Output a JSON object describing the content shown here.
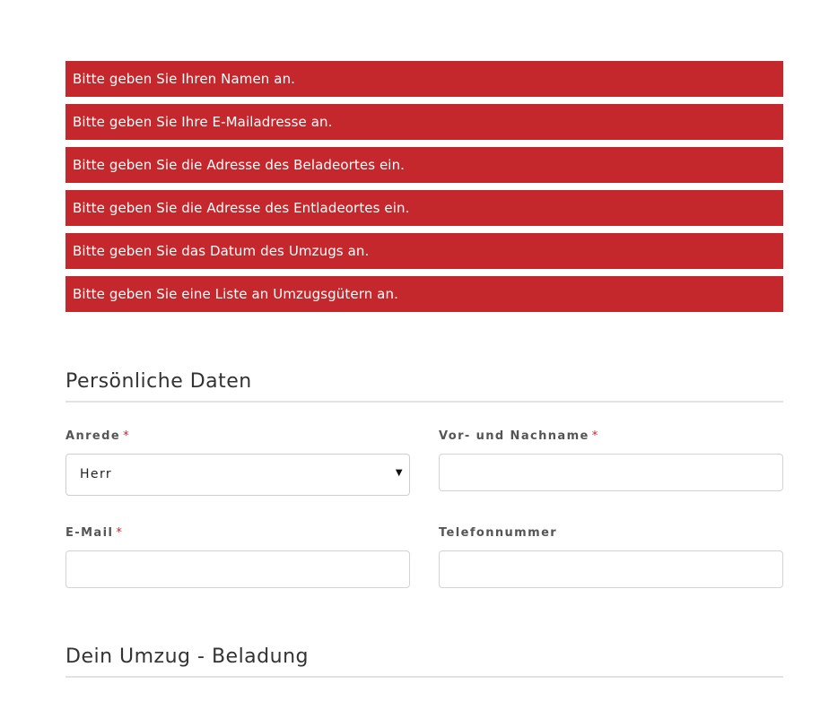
{
  "errors": [
    "Bitte geben Sie Ihren Namen an.",
    "Bitte geben Sie Ihre E-Mailadresse an.",
    "Bitte geben Sie die Adresse des Beladeortes ein.",
    "Bitte geben Sie die Adresse des Entladeortes ein.",
    "Bitte geben Sie das Datum des Umzugs an.",
    "Bitte geben Sie eine Liste an Umzugsgütern an."
  ],
  "personal": {
    "title": "Persönliche Daten",
    "anrede": {
      "label": "Anrede",
      "required_mark": "*",
      "selected": "Herr"
    },
    "name": {
      "label": "Vor- und Nachname",
      "required_mark": "*",
      "value": ""
    },
    "email": {
      "label": "E-Mail",
      "required_mark": "*",
      "value": ""
    },
    "phone": {
      "label": "Telefonnummer",
      "value": ""
    }
  },
  "loading": {
    "title": "Dein Umzug - Beladung"
  },
  "icons": {
    "select_caret": "triangle-down-icon"
  },
  "colors": {
    "error_bg": "#c4282d",
    "required": "#c4282d",
    "divider": "#e2e2e2"
  }
}
